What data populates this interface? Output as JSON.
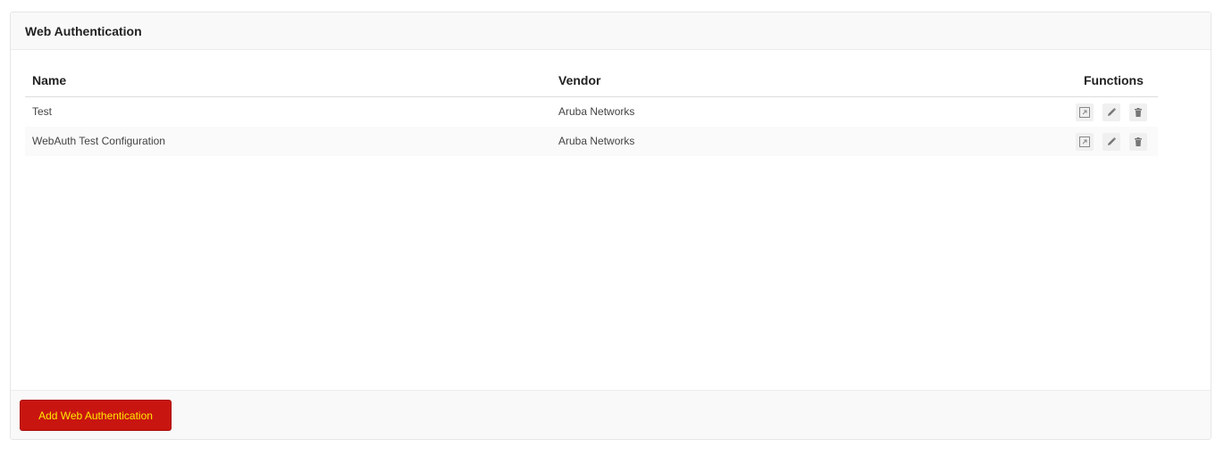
{
  "panel": {
    "title": "Web Authentication"
  },
  "table": {
    "columns": {
      "name": "Name",
      "vendor": "Vendor",
      "functions": "Functions"
    },
    "rows": [
      {
        "name": "Test",
        "vendor": "Aruba Networks"
      },
      {
        "name": "WebAuth Test Configuration",
        "vendor": "Aruba Networks"
      }
    ],
    "row_actions": [
      "open-external-icon",
      "pencil-icon",
      "trash-icon"
    ]
  },
  "footer": {
    "add_button_label": "Add Web Authentication"
  },
  "colors": {
    "button_bg": "#c91510",
    "button_text": "#ffe800",
    "icon": "#777777"
  }
}
